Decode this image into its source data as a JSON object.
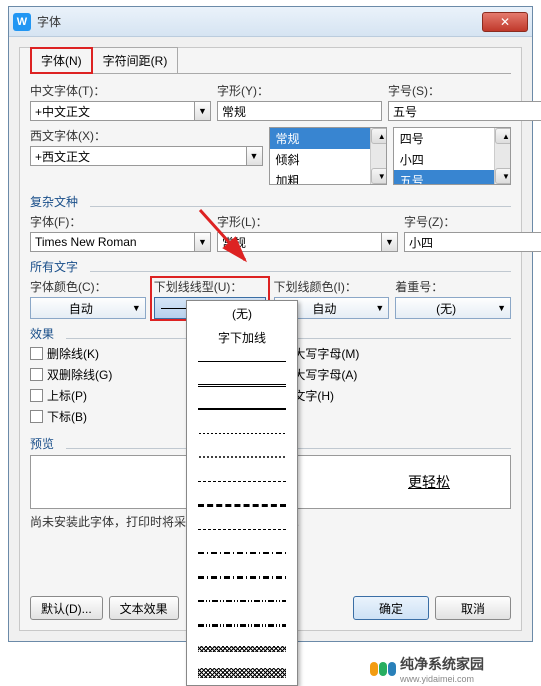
{
  "window": {
    "title": "字体"
  },
  "tabs": {
    "font": "字体(N)",
    "spacing": "字符间距(R)"
  },
  "labels": {
    "cn_font": "中文字体(T)：",
    "en_font": "西文字体(X)：",
    "style": "字形(Y)：",
    "size": "字号(S)：",
    "complex_section": "复杂文种",
    "font_f": "字体(F)：",
    "style_l": "字形(L)：",
    "size_z": "字号(Z)：",
    "all_text": "所有文字",
    "font_color": "字体颜色(C)：",
    "underline_type": "下划线线型(U)：",
    "underline_color": "下划线颜色(I)：",
    "emphasis": "着重号：",
    "effects": "效果",
    "preview": "预览",
    "install_note": "尚未安装此字体，打印时将采用最相近的有效字体。"
  },
  "values": {
    "cn_font": "+中文正文",
    "en_font": "+西文正文",
    "style": "常规",
    "size": "五号",
    "font_f": "Times New Roman",
    "style_l": "常规",
    "size_z": "小四",
    "font_color": "自动",
    "underline_color": "自动",
    "emphasis": "(无)",
    "preview_text": "更轻松"
  },
  "style_list": [
    "常规",
    "倾斜",
    "加粗"
  ],
  "size_list": [
    "四号",
    "小四",
    "五号"
  ],
  "checks": {
    "strike": "删除线(K)",
    "dbl_strike": "双删除线(G)",
    "superscript": "上标(P)",
    "subscript": "下标(B)",
    "smallcaps": "小型大写字母(M)",
    "allcaps": "全部大写字母(A)",
    "hidden": "隐藏文字(H)"
  },
  "underline_options": {
    "none": "(无)",
    "word": "字下加线"
  },
  "buttons": {
    "default": "默认(D)...",
    "text_effect": "文本效果",
    "ok": "确定",
    "cancel": "取消"
  },
  "footer": {
    "brand": "纯净系统家园",
    "url": "www.yidaimei.com"
  }
}
